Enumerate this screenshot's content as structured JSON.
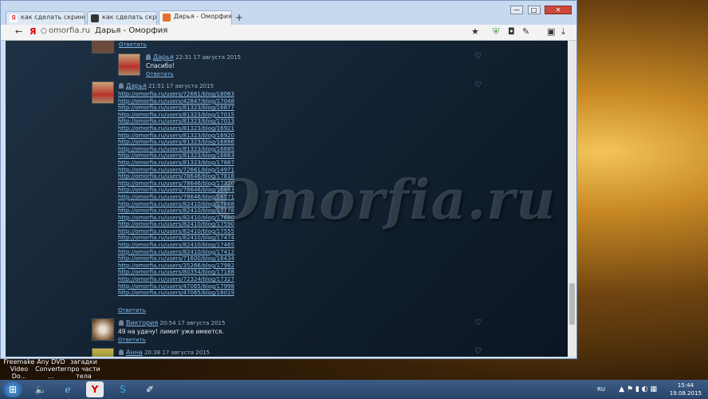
{
  "browser": {
    "tabs": [
      {
        "label": "как сделать скринш",
        "active": false
      },
      {
        "label": "как сделать скринш",
        "active": false
      },
      {
        "label": "Дарья - Оморфия",
        "active": true
      }
    ],
    "new_tab": "+",
    "address": "omorfia.ru",
    "page_title": "Дарья - Оморфия",
    "window_controls": {
      "minimize": "—",
      "maximize": "□",
      "close": "✕"
    }
  },
  "site": {
    "watermark": "Omorfia.ru",
    "top_reply": "Ответить",
    "comments": [
      {
        "author": "Дарья",
        "date": "22:31 17 августа 2015",
        "text": "Спасибо!",
        "reply": "Ответить"
      },
      {
        "author": "Дарья",
        "date": "21:51 17 августа 2015",
        "reply": "Ответить",
        "links": [
          "http://omorfia.ru/users/72661/blog/18063",
          "http://omorfia.ru/users/42847/blog/17048",
          "http://omorfia.ru/users/81323/blog/16877",
          "http://omorfia.ru/users/81323/blog/17015",
          "http://omorfia.ru/users/81323/blog/17013",
          "http://omorfia.ru/users/81323/blog/16921",
          "http://omorfia.ru/users/81323/blog/16920",
          "http://omorfia.ru/users/81323/blog/16886",
          "http://omorfia.ru/users/81323/blog/16885",
          "http://omorfia.ru/users/81323/blog/16883",
          "http://omorfia.ru/users/81323/blog/17887",
          "http://omorfia.ru/users/72661/blog/14971",
          "http://omorfia.ru/users/78646/blog/17818",
          "http://omorfia.ru/users/78646/blog/17320",
          "http://omorfia.ru/users/78646/blog/16893",
          "http://omorfia.ru/users/78646/blog/16571",
          "http://omorfia.ru/users/82410/blog/17868",
          "http://omorfia.ru/users/82410/blog/17778",
          "http://omorfia.ru/users/82410/blog/17680",
          "http://omorfia.ru/users/82410/blog/17590",
          "http://omorfia.ru/users/82410/blog/17555",
          "http://omorfia.ru/users/82410/blog/17474",
          "http://omorfia.ru/users/82410/blog/17465",
          "http://omorfia.ru/users/82410/blog/17412",
          "http://omorfia.ru/users/71600/blog/16434",
          "http://omorfia.ru/users/35266/blog/17982",
          "http://omorfia.ru/users/80354/blog/17188",
          "http://omorfia.ru/users/72324/blog/17327",
          "http://omorfia.ru/users/47065/blog/17998",
          "http://omorfia.ru/users/47065/blog/18019"
        ]
      },
      {
        "author": "Виктория",
        "date": "20:54 17 августа 2015",
        "text": "49 на удачу! лимит уже имеется.",
        "reply": "Ответить"
      },
      {
        "author": "Анна",
        "date": "20:38 17 августа 2015"
      }
    ]
  },
  "desktop_icons": [
    {
      "label": "Freemake Video Do..."
    },
    {
      "label": "Any DVD Converter ..."
    },
    {
      "label": "загадки про части тела"
    }
  ],
  "taskbar": {
    "language": "RU",
    "time": "15:44",
    "date": "19.08.2015"
  },
  "colors": {
    "accent_link": "#8cc3ee",
    "page_bg": "#152536",
    "taskbar": "#2f4e78"
  }
}
